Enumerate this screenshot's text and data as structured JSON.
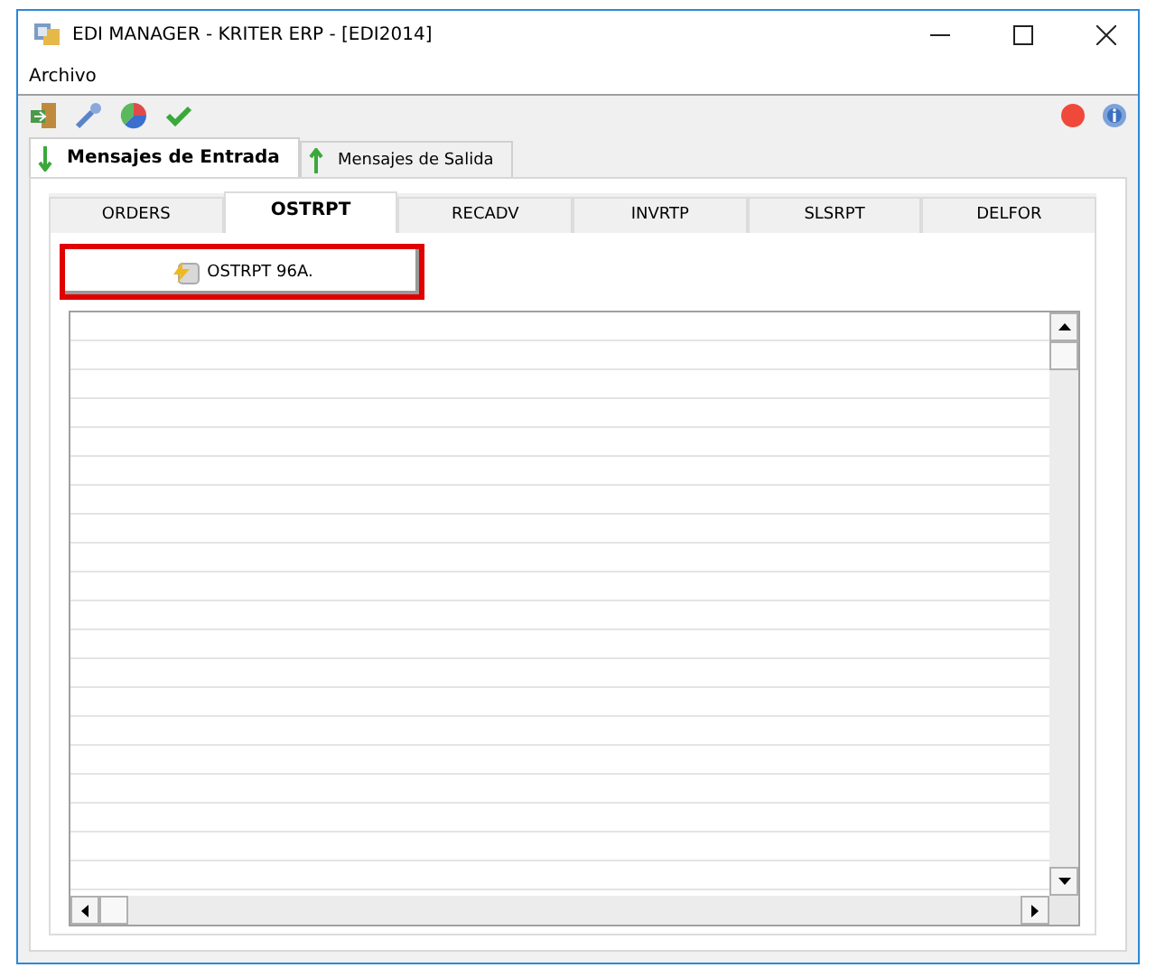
{
  "window": {
    "title": "EDI MANAGER - KRITER ERP - [EDI2014]"
  },
  "menu": [
    "Archivo"
  ],
  "outer_tabs": [
    {
      "label": "Mensajes de Entrada",
      "kind": "in",
      "selected": true
    },
    {
      "label": "Mensajes de Salida",
      "kind": "out",
      "selected": false
    }
  ],
  "inner_tabs": [
    {
      "label": "ORDERS",
      "selected": false
    },
    {
      "label": "OSTRPT",
      "selected": true
    },
    {
      "label": "RECADV",
      "selected": false
    },
    {
      "label": "INVRTP",
      "selected": false
    },
    {
      "label": "SLSRPT",
      "selected": false
    },
    {
      "label": "DELFOR",
      "selected": false
    }
  ],
  "action_button": {
    "label": "OSTRPT 96A.",
    "highlighted": true
  }
}
